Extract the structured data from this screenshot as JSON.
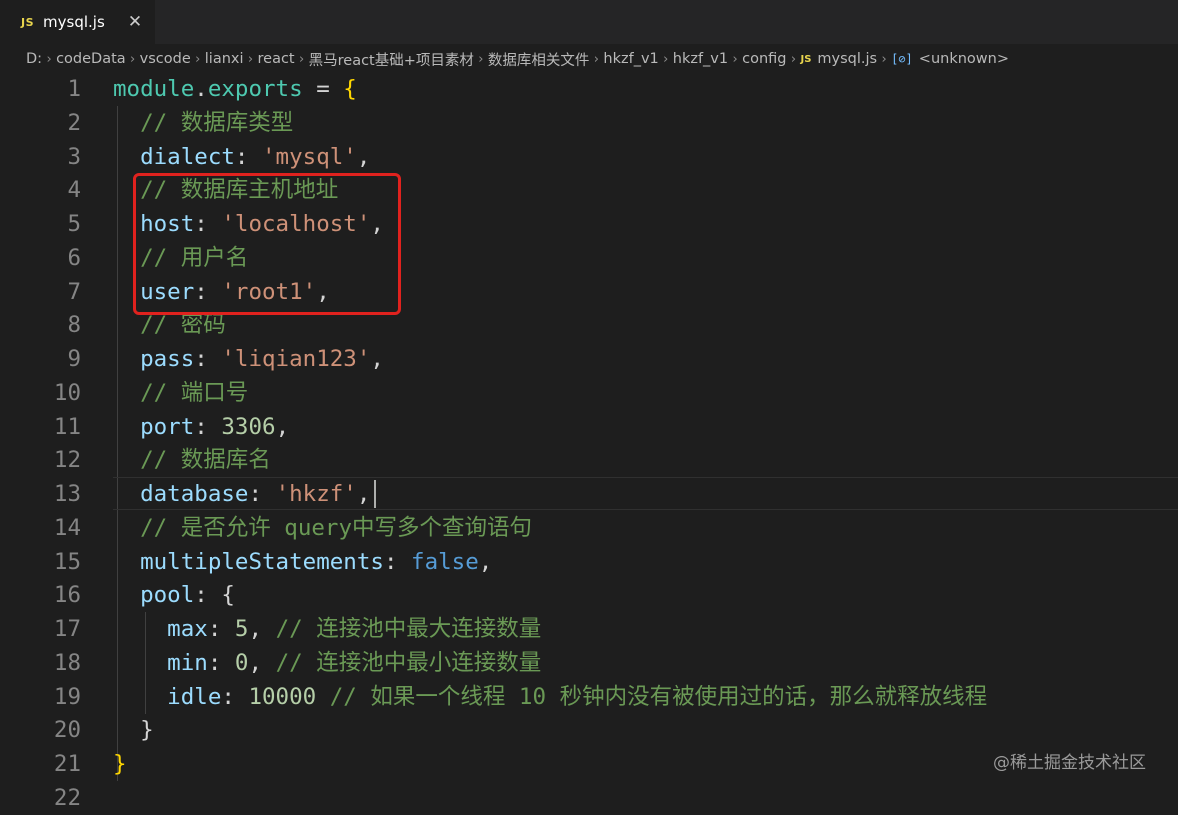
{
  "tab": {
    "badge": "JS",
    "label": "mysql.js",
    "close": "✕"
  },
  "breadcrumb": [
    "D:",
    "codeData",
    "vscode",
    "lianxi",
    "react",
    "黑马react基础+项目素材",
    "数据库相关文件",
    "hkzf_v1",
    "hkzf_v1",
    "config",
    "mysql.js",
    "<unknown>"
  ],
  "breadcrumb_js_badge": "JS",
  "breadcrumb_symbol_icon": "[⊘]",
  "lines": [
    {
      "n": "1",
      "tokens": [
        [
          "kw-fn",
          "module"
        ],
        [
          "punct",
          "."
        ],
        [
          "kw-fn",
          "exports"
        ],
        [
          "punct",
          " = "
        ],
        [
          "brace",
          "{"
        ]
      ]
    },
    {
      "n": "2",
      "tokens": [
        [
          "cmt",
          "  // 数据库类型"
        ]
      ]
    },
    {
      "n": "3",
      "tokens": [
        [
          "prop",
          "  dialect"
        ],
        [
          "punct",
          ": "
        ],
        [
          "str",
          "'mysql'"
        ],
        [
          "punct",
          ","
        ]
      ]
    },
    {
      "n": "4",
      "tokens": [
        [
          "cmt",
          "  // 数据库主机地址"
        ]
      ]
    },
    {
      "n": "5",
      "tokens": [
        [
          "prop",
          "  host"
        ],
        [
          "punct",
          ": "
        ],
        [
          "str",
          "'localhost'"
        ],
        [
          "punct",
          ","
        ]
      ]
    },
    {
      "n": "6",
      "tokens": [
        [
          "cmt",
          "  // 用户名"
        ]
      ]
    },
    {
      "n": "7",
      "tokens": [
        [
          "prop",
          "  user"
        ],
        [
          "punct",
          ": "
        ],
        [
          "str",
          "'root1'"
        ],
        [
          "punct",
          ","
        ]
      ]
    },
    {
      "n": "8",
      "tokens": [
        [
          "cmt",
          "  // 密码"
        ]
      ]
    },
    {
      "n": "9",
      "tokens": [
        [
          "prop",
          "  pass"
        ],
        [
          "punct",
          ": "
        ],
        [
          "str",
          "'liqian123'"
        ],
        [
          "punct",
          ","
        ]
      ]
    },
    {
      "n": "10",
      "tokens": [
        [
          "cmt",
          "  // 端口号"
        ]
      ]
    },
    {
      "n": "11",
      "tokens": [
        [
          "prop",
          "  port"
        ],
        [
          "punct",
          ": "
        ],
        [
          "num",
          "3306"
        ],
        [
          "punct",
          ","
        ]
      ]
    },
    {
      "n": "12",
      "tokens": [
        [
          "cmt",
          "  // 数据库名"
        ]
      ]
    },
    {
      "n": "13",
      "tokens": [
        [
          "prop",
          "  database"
        ],
        [
          "punct",
          ": "
        ],
        [
          "str",
          "'hkzf'"
        ],
        [
          "punct",
          ","
        ]
      ]
    },
    {
      "n": "14",
      "tokens": [
        [
          "cmt",
          "  // 是否允许 query中写多个查询语句"
        ]
      ]
    },
    {
      "n": "15",
      "tokens": [
        [
          "prop",
          "  multipleStatements"
        ],
        [
          "punct",
          ": "
        ],
        [
          "bool",
          "false"
        ],
        [
          "punct",
          ","
        ]
      ]
    },
    {
      "n": "16",
      "tokens": [
        [
          "prop",
          "  pool"
        ],
        [
          "punct",
          ": "
        ],
        [
          "punct",
          "{"
        ]
      ]
    },
    {
      "n": "17",
      "tokens": [
        [
          "prop",
          "    max"
        ],
        [
          "punct",
          ": "
        ],
        [
          "num",
          "5"
        ],
        [
          "punct",
          ", "
        ],
        [
          "cmt",
          "// 连接池中最大连接数量"
        ]
      ]
    },
    {
      "n": "18",
      "tokens": [
        [
          "prop",
          "    min"
        ],
        [
          "punct",
          ": "
        ],
        [
          "num",
          "0"
        ],
        [
          "punct",
          ", "
        ],
        [
          "cmt",
          "// 连接池中最小连接数量"
        ]
      ]
    },
    {
      "n": "19",
      "tokens": [
        [
          "prop",
          "    idle"
        ],
        [
          "punct",
          ": "
        ],
        [
          "num",
          "10000"
        ],
        [
          "punct",
          " "
        ],
        [
          "cmt",
          "// 如果一个线程 10 秒钟内没有被使用过的话，那么就释放线程"
        ]
      ]
    },
    {
      "n": "20",
      "tokens": [
        [
          "punct",
          "  }"
        ]
      ]
    },
    {
      "n": "21",
      "tokens": [
        [
          "brace",
          "}"
        ]
      ]
    },
    {
      "n": "22",
      "tokens": []
    }
  ],
  "watermark": "@稀土掘金技术社区",
  "colors": {
    "highlight_box": "#e0221e",
    "background": "#1e1e1e"
  }
}
